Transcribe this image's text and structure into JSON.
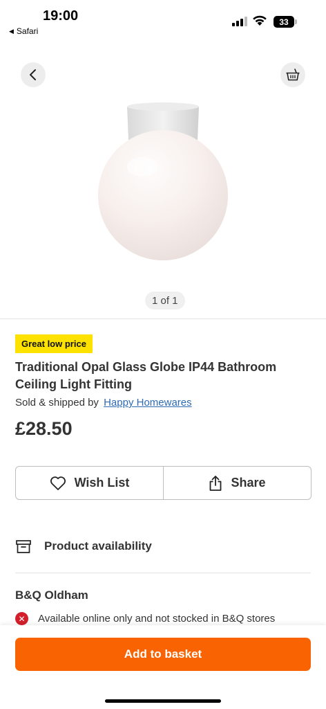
{
  "status_bar": {
    "time": "19:00",
    "back_app": "Safari",
    "battery": "33"
  },
  "gallery": {
    "pager": "1 of 1",
    "icons": {
      "back": "chevron-left-icon",
      "basket": "basket-icon"
    }
  },
  "product": {
    "badge": "Great low price",
    "title": "Traditional Opal Glass Globe IP44 Bathroom Ceiling Light Fitting",
    "sold_by_prefix": "Sold & shipped by",
    "seller": "Happy Homewares",
    "price": "£28.50"
  },
  "actions": {
    "wishlist_label": "Wish List",
    "share_label": "Share"
  },
  "availability": {
    "heading": "Product availability",
    "store_name": "B&Q Oldham",
    "stock_message": "Available online only and not stocked in B&Q stores"
  },
  "cta": {
    "add_to_basket": "Add to basket",
    "color": "#f96302"
  },
  "colors": {
    "badge": "#fde200",
    "link": "#2d6bb4",
    "error": "#d21f2b"
  }
}
